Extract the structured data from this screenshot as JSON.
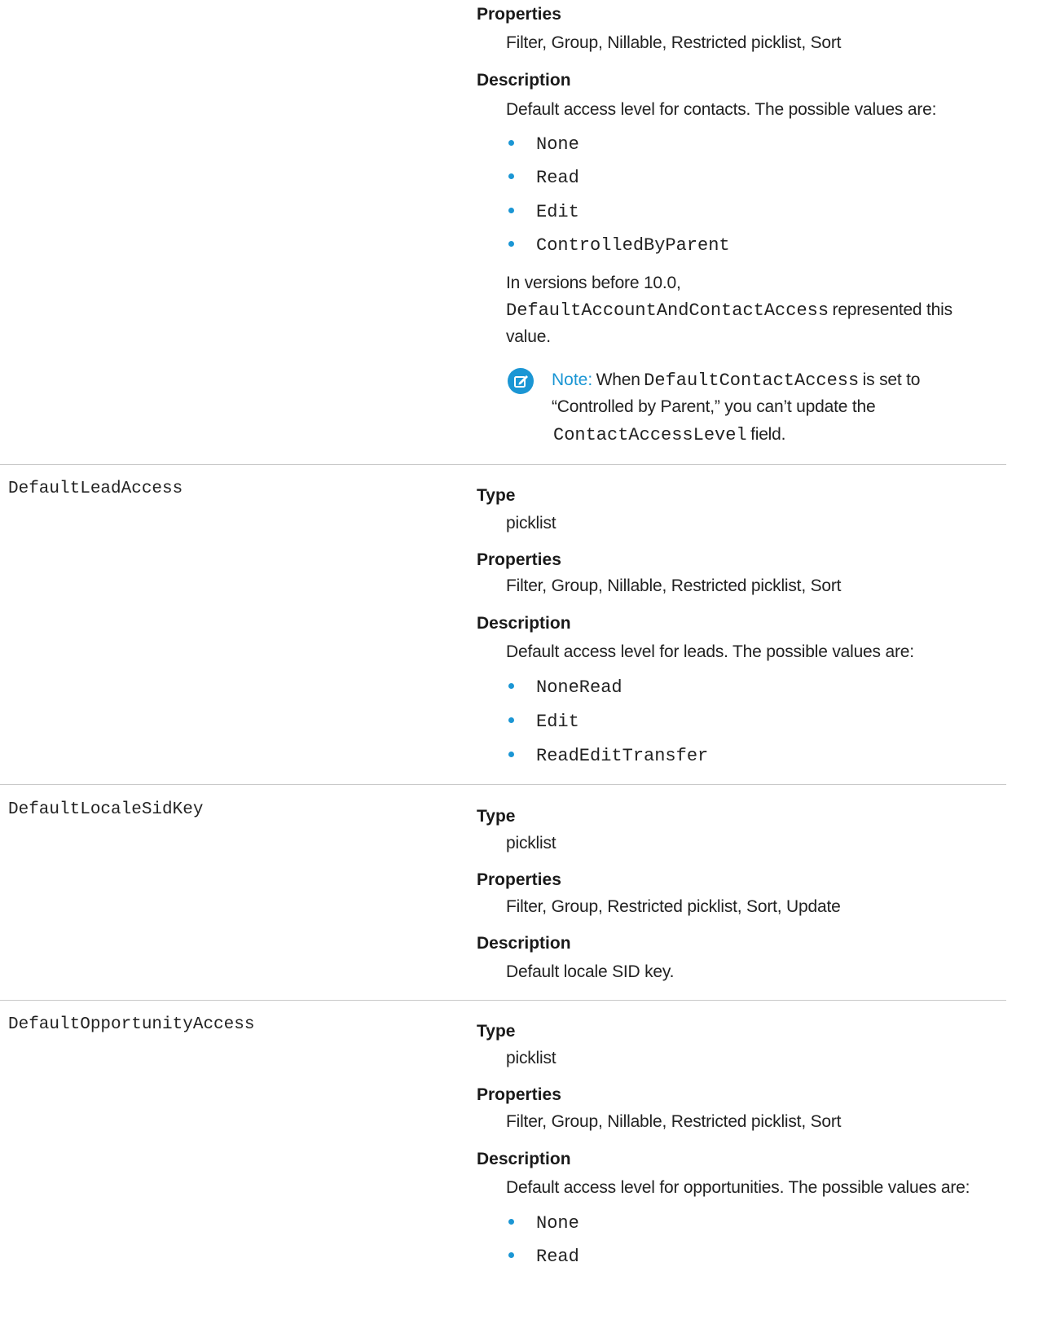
{
  "sections": [
    {
      "name": "",
      "properties_label": "Properties",
      "properties_value": "Filter, Group, Nillable, Restricted picklist, Sort",
      "description_label": "Description",
      "description_text": "Default access level for contacts. The possible values are:",
      "values": [
        "None",
        "Read",
        "Edit",
        "ControlledByParent"
      ],
      "extra_line1": "In versions before 10.0,",
      "extra_code": "DefaultAccountAndContactAccess",
      "extra_line2_suffix": "represented this",
      "extra_line3": "value.",
      "note": {
        "label": "Note:",
        "text_pre": "When",
        "code1": "DefaultContactAccess",
        "text_mid": "is set to",
        "text_line2": "“Controlled by Parent,” you can’t update the",
        "code2": "ContactAccessLevel",
        "text_post": "field."
      }
    },
    {
      "name": "DefaultLeadAccess",
      "type_label": "Type",
      "type_value": "picklist",
      "properties_label": "Properties",
      "properties_value": "Filter, Group, Nillable, Restricted picklist, Sort",
      "description_label": "Description",
      "description_text": "Default access level for leads. The possible values are:",
      "values": [
        "NoneRead",
        "Edit",
        "ReadEditTransfer"
      ]
    },
    {
      "name": "DefaultLocaleSidKey",
      "type_label": "Type",
      "type_value": "picklist",
      "properties_label": "Properties",
      "properties_value": "Filter, Group, Restricted picklist, Sort, Update",
      "description_label": "Description",
      "description_text": "Default locale SID key."
    },
    {
      "name": "DefaultOpportunityAccess",
      "type_label": "Type",
      "type_value": "picklist",
      "properties_label": "Properties",
      "properties_value": "Filter, Group, Nillable, Restricted picklist, Sort",
      "description_label": "Description",
      "description_text": "Default access level for opportunities. The possible values are:",
      "values": [
        "None",
        "Read"
      ]
    }
  ],
  "colors": {
    "accent": "#1b96d4",
    "rule": "#c9c9c9",
    "text": "#222222"
  }
}
